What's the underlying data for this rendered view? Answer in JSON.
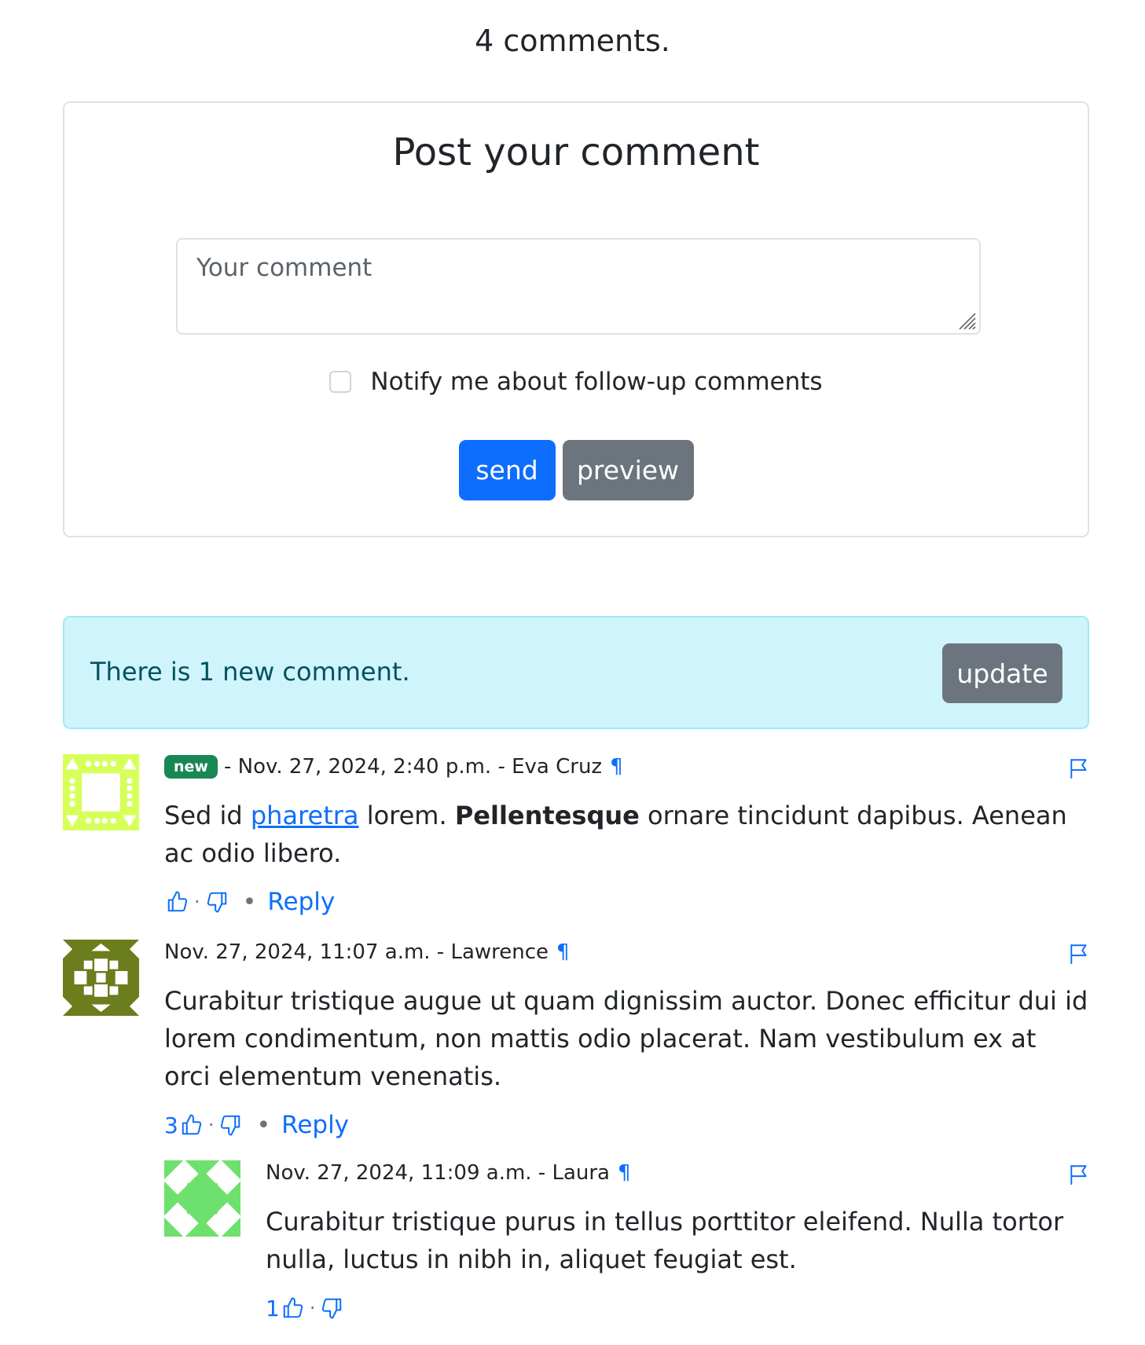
{
  "comments_count": "4 comments.",
  "form": {
    "title": "Post your comment",
    "textarea_placeholder": "Your comment",
    "notify_label": "Notify me about follow-up comments",
    "send_label": "send",
    "preview_label": "preview"
  },
  "alert": {
    "text": "There is 1 new comment.",
    "update_label": "update"
  },
  "comments": [
    {
      "badge": "new",
      "meta": "- Nov. 27, 2024, 2:40 p.m. - Eva Cruz",
      "text_before": "Sed id ",
      "link": "pharetra",
      "text_mid": " lorem. ",
      "bold": "Pellentesque",
      "text_after": " ornare tincidunt dapibus. Aenean ac odio libero.",
      "likes": "",
      "reply": "Reply",
      "avatar_color": "#d7ff5a"
    },
    {
      "meta": "Nov. 27, 2024, 11:07 a.m. - Lawrence",
      "text": "Curabitur tristique augue ut quam dignissim auctor. Donec efficitur dui id lorem condimentum, non mattis odio placerat. Nam vestibulum ex at orci elementum venenatis.",
      "likes": "3",
      "reply": "Reply",
      "avatar_color": "#6b7d1c"
    },
    {
      "meta": "Nov. 27, 2024, 11:09 a.m. - Laura",
      "text": "Curabitur tristique purus in tellus porttitor eleifend. Nulla tortor nulla, luctus in nibh in, aliquet feugiat est.",
      "likes": "1",
      "avatar_color": "#6ee06e"
    }
  ],
  "pilcrow": "¶",
  "colors": {
    "primary": "#0d6efd",
    "secondary": "#6c757d",
    "info_bg": "#cff4fc",
    "success": "#198754"
  }
}
